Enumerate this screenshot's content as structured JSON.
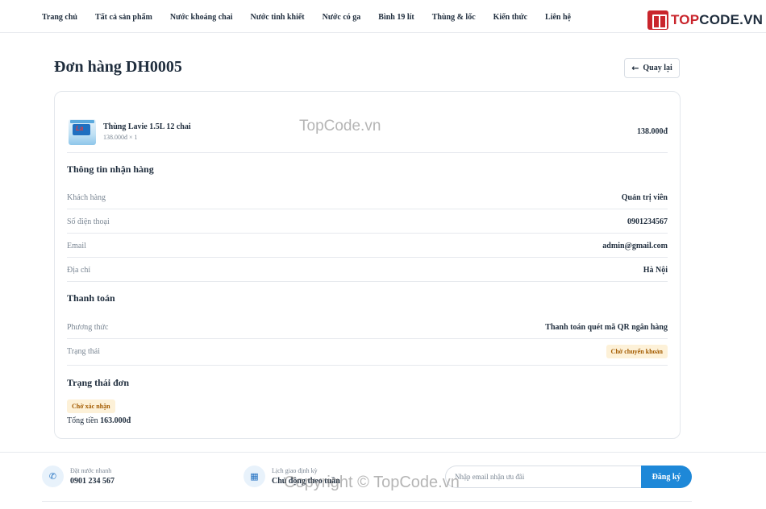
{
  "nav": {
    "items": [
      "Trang chủ",
      "Tất cả sản phẩm",
      "Nước khoáng chai",
      "Nước tinh khiết",
      "Nước có ga",
      "Bình 19 lít",
      "Thùng & lốc",
      "Kiến thức",
      "Liên hệ"
    ]
  },
  "logo": {
    "part1": "TOP",
    "part2": "CODE.VN"
  },
  "page": {
    "title": "Đơn hàng DH0005",
    "back_label": "Quay lại"
  },
  "product": {
    "name": "Thùng Lavie 1.5L 12 chai",
    "sub": "138.000đ × 1",
    "price": "138.000đ"
  },
  "shipping": {
    "title": "Thông tin nhận hàng",
    "rows": [
      {
        "label": "Khách hàng",
        "value": "Quản trị viên"
      },
      {
        "label": "Số điện thoại",
        "value": "0901234567"
      },
      {
        "label": "Email",
        "value": "admin@gmail.com"
      },
      {
        "label": "Địa chỉ",
        "value": "Hà Nội"
      }
    ]
  },
  "payment": {
    "title": "Thanh toán",
    "method_label": "Phương thức",
    "method_value": "Thanh toán quét mã QR ngân hàng",
    "status_label": "Trạng thái",
    "status_value": "Chờ chuyển khoản"
  },
  "order_status": {
    "title": "Trạng thái đơn",
    "badge": "Chờ xác nhận",
    "total_label": "Tổng tiền",
    "total_value": "163.000đ"
  },
  "footer": {
    "order_small": "Đặt nước nhanh",
    "order_big": "0901 234 567",
    "schedule_small": "Lịch giao định kỳ",
    "schedule_big": "Chủ động theo tuần",
    "email_placeholder": "Nhập email nhận ưu đãi",
    "subscribe_label": "Đăng ký"
  },
  "watermark": {
    "top": "TopCode.vn",
    "bottom": "Copyright © TopCode.vn"
  },
  "colors": {
    "accent": "#1e88d8",
    "brand_red": "#c9252c",
    "badge_bg": "#fdf1d8",
    "badge_text": "#a35b00"
  }
}
